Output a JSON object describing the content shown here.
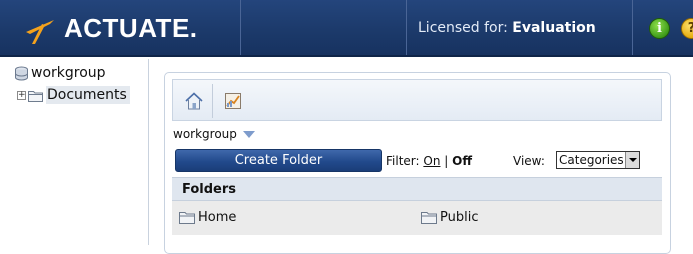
{
  "header": {
    "brand": "ACTUATE.",
    "license_label": "Licensed for:",
    "license_value": "Evaluation",
    "info_glyph": "i",
    "help_glyph": "?"
  },
  "tree": {
    "root_label": "workgroup",
    "root_icon": "database-icon",
    "child_expander": "+",
    "child_label": "Documents",
    "child_icon": "folder-icon"
  },
  "toolbar": {
    "home_icon": "home-icon",
    "second_icon": "report-icon"
  },
  "breadcrumb": {
    "label": "workgroup"
  },
  "actions": {
    "create_folder": "Create Folder",
    "filter_label": "Filter:",
    "filter_on": "On",
    "filter_sep": "|",
    "filter_off": "Off",
    "view_label": "View:",
    "view_selected": "Categories"
  },
  "folders": {
    "header": "Folders",
    "items": [
      {
        "label": "Home"
      },
      {
        "label": "Public"
      }
    ]
  },
  "colors": {
    "header_bg": "#1c3a6b",
    "button_bg": "#224a8c",
    "panel_header_bg": "#dfe6ef"
  }
}
